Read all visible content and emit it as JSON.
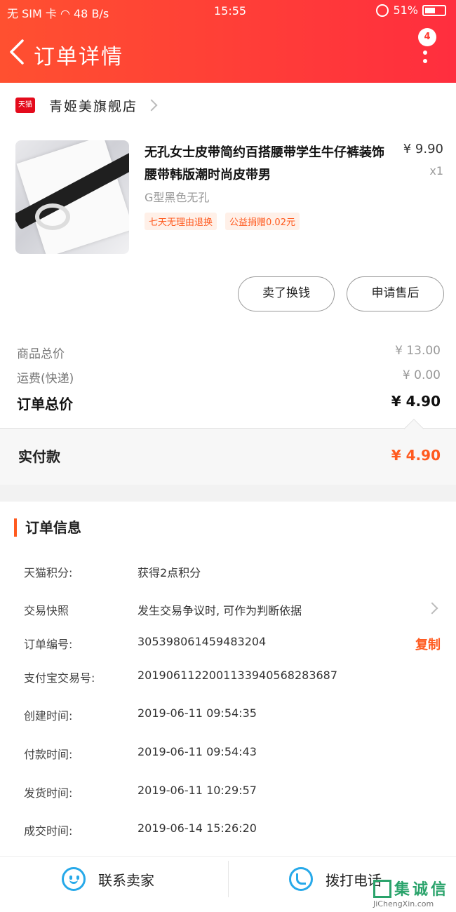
{
  "status_bar": {
    "carrier": "无 SIM 卡",
    "speed": "48 B/s",
    "time": "15:55",
    "battery": "51%"
  },
  "header": {
    "title": "订单详情",
    "menu_badge": "4"
  },
  "store": {
    "logo_text": "天猫",
    "name": "青姬美旗舰店"
  },
  "product": {
    "name": "无孔女士皮带简约百搭腰带学生牛仔裤装饰腰带韩版潮时尚皮带男",
    "price": "¥ 9.90",
    "qty": "x1",
    "sku": "G型黑色无孔",
    "tags": [
      "七天无理由退换",
      "公益捐赠0.02元"
    ]
  },
  "actions": {
    "sell": "卖了换钱",
    "after_sale": "申请售后"
  },
  "summary": {
    "goods_total_label": "商品总价",
    "goods_total": "¥ 13.00",
    "shipping_label": "运费(快递)",
    "shipping": "¥ 0.00",
    "order_total_label": "订单总价",
    "order_total": "¥ 4.90",
    "paid_label": "实付款",
    "paid": "¥ 4.90"
  },
  "order_info": {
    "title": "订单信息",
    "rows": [
      {
        "label": "天猫积分:",
        "value": "获得2点积分"
      },
      {
        "label": "交易快照",
        "value": "发生交易争议时, 可作为判断依据"
      },
      {
        "label": "订单编号:",
        "value": "305398061459483204",
        "action": "复制"
      },
      {
        "label": "支付宝交易号:",
        "value": "2019061122001133940568283687"
      },
      {
        "label": "创建时间:",
        "value": "2019-06-11 09:54:35"
      },
      {
        "label": "付款时间:",
        "value": "2019-06-11 09:54:43"
      },
      {
        "label": "发货时间:",
        "value": "2019-06-11 10:29:57"
      },
      {
        "label": "成交时间:",
        "value": "2019-06-14 15:26:20"
      }
    ]
  },
  "bottom_bar": {
    "contact": "联系卖家",
    "call": "拨打电话"
  },
  "watermark": {
    "text": "集诚信",
    "url": "JiChengXin.com"
  },
  "colors": {
    "header_start": "#ff5030",
    "header_end": "#ff2e3e",
    "accent": "#ff5a1f",
    "icon_blue": "#27a9e9"
  }
}
